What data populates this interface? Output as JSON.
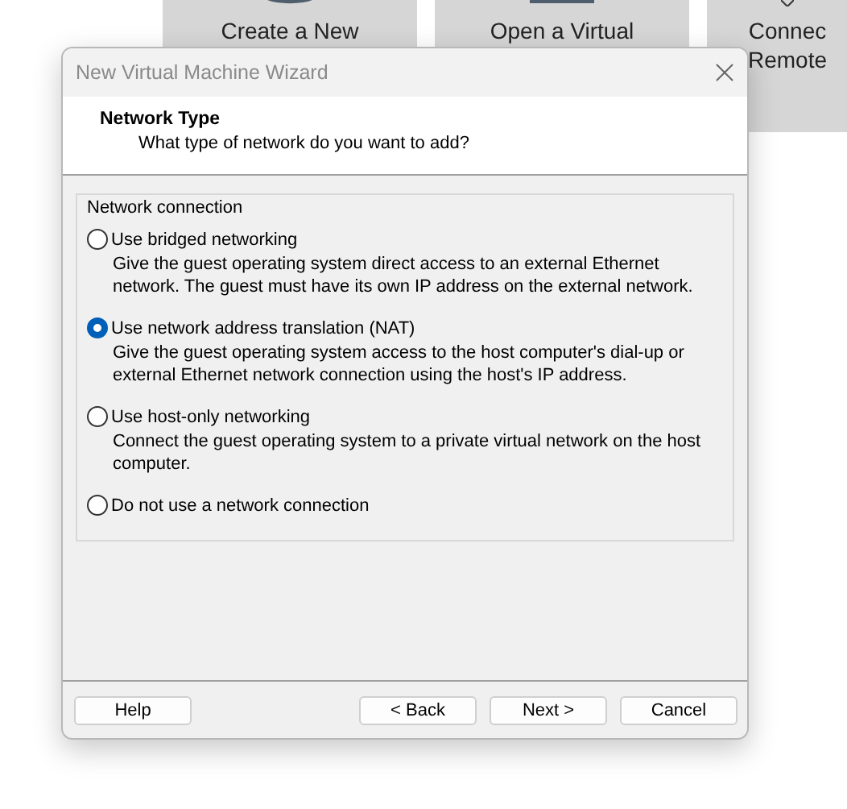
{
  "background_tiles": [
    {
      "lines": [
        "Create a New"
      ]
    },
    {
      "lines": [
        "Open a Virtual"
      ]
    },
    {
      "lines": [
        "Connec",
        "Remote"
      ]
    }
  ],
  "window": {
    "title": "New Virtual Machine Wizard"
  },
  "header": {
    "title": "Network Type",
    "subtitle": "What type of network do you want to add?"
  },
  "group": {
    "label": "Network connection",
    "options": [
      {
        "label": "Use bridged networking",
        "description": "Give the guest operating system direct access to an external Ethernet network. The guest must have its own IP address on the external network.",
        "selected": false
      },
      {
        "label": "Use network address translation (NAT)",
        "description": "Give the guest operating system access to the host computer's dial-up or external Ethernet network connection using the host's IP address.",
        "selected": true
      },
      {
        "label": "Use host-only networking",
        "description": "Connect the guest operating system to a private virtual network on the host computer.",
        "selected": false
      },
      {
        "label": "Do not use a network connection",
        "selected": false
      }
    ]
  },
  "buttons": [
    {
      "label": "Help",
      "kind": "help"
    },
    {
      "label": "< Back",
      "kind": "nav"
    },
    {
      "label": "Next >",
      "kind": "nav"
    },
    {
      "label": "Cancel",
      "kind": "nav"
    }
  ]
}
